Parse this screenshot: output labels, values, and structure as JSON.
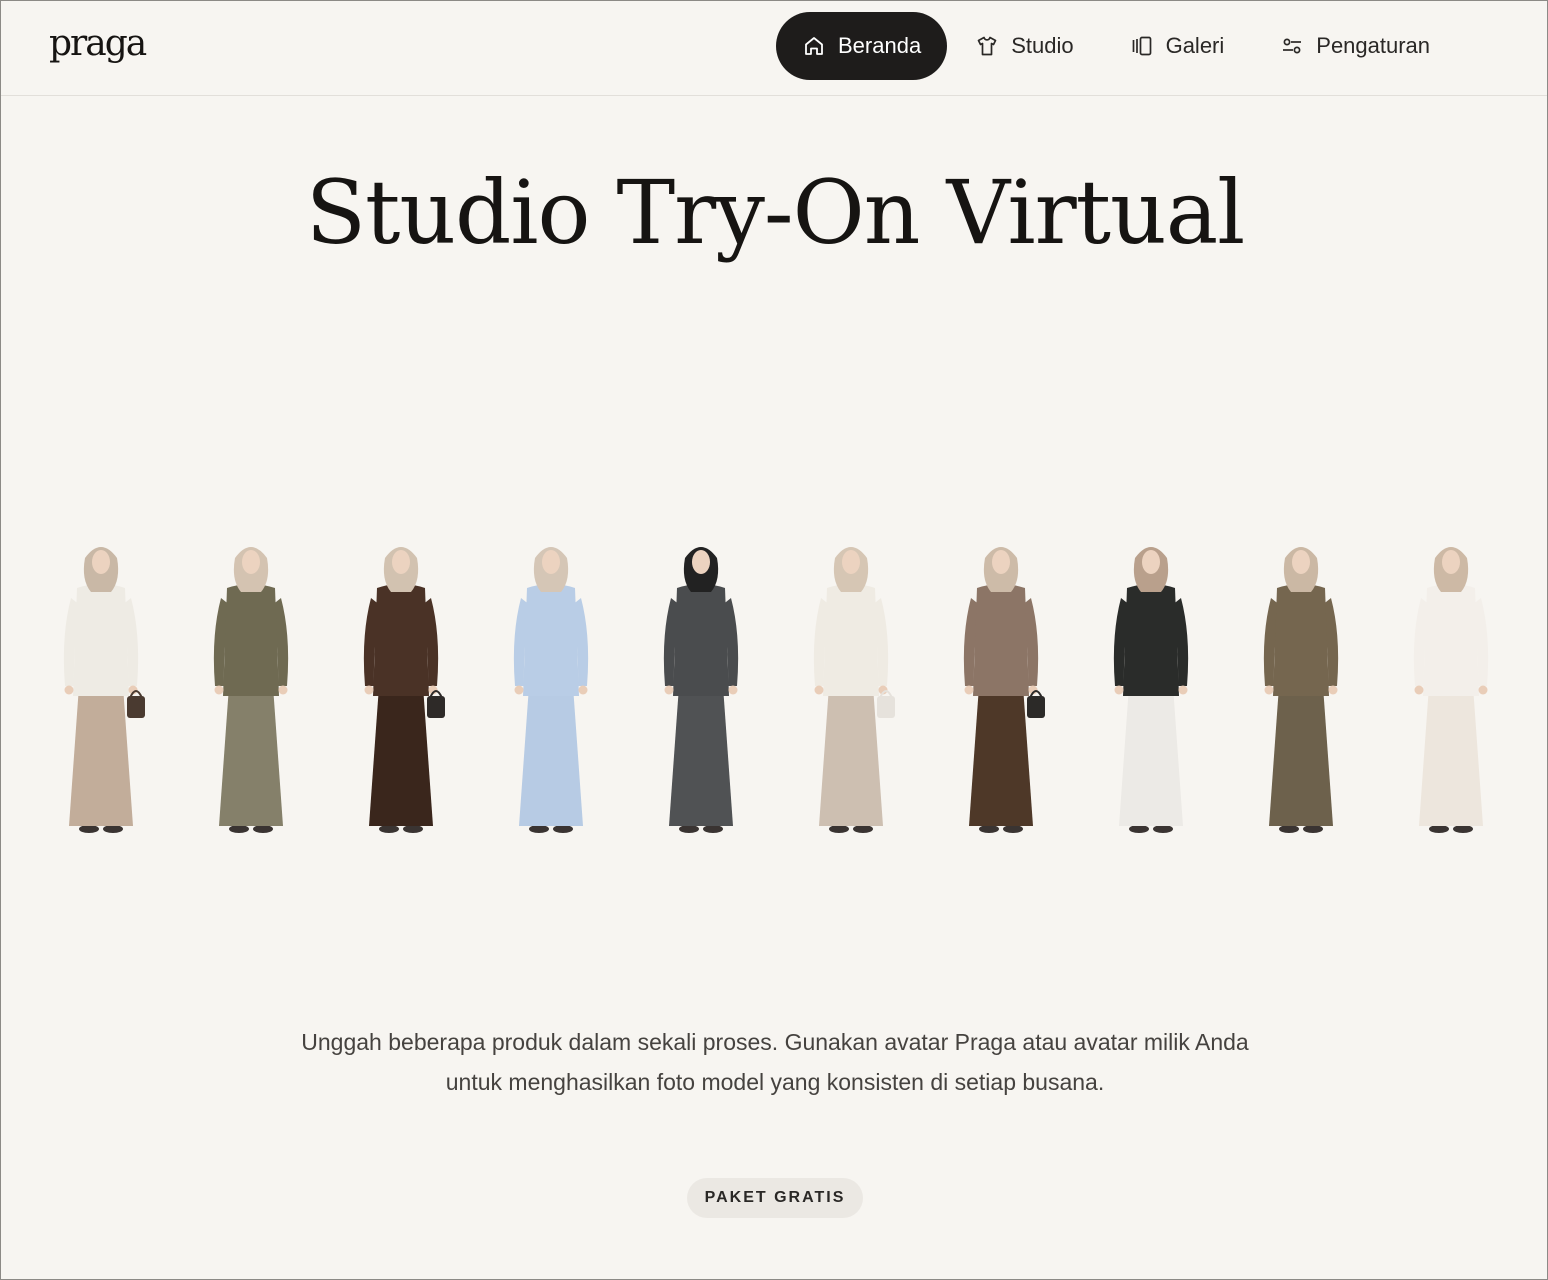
{
  "brand": {
    "logo_text": "praga"
  },
  "nav": {
    "items": [
      {
        "label": "Beranda",
        "icon": "home-icon",
        "active": true
      },
      {
        "label": "Studio",
        "icon": "shirt-icon",
        "active": false
      },
      {
        "label": "Galeri",
        "icon": "gallery-icon",
        "active": false
      },
      {
        "label": "Pengaturan",
        "icon": "sliders-icon",
        "active": false
      }
    ]
  },
  "hero": {
    "title": "Studio Try-On Virtual",
    "description": "Unggah beberapa produk dalam sekali proses. Gunakan avatar Praga atau avatar milik Anda untuk menghasilkan foto model yang konsisten di setiap busana.",
    "badge": "PAKET GRATIS"
  },
  "models": [
    {
      "hijab": "#c9b8a6",
      "top": "#eeebe4",
      "bottom": "#c2ad9a",
      "bag": "#4a3a30"
    },
    {
      "hijab": "#d4c3b1",
      "top": "#6f6a52",
      "bottom": "#85806a",
      "bag": ""
    },
    {
      "hijab": "#d2c2b0",
      "top": "#4a3226",
      "bottom": "#3a261c",
      "bag": "#2e2a28"
    },
    {
      "hijab": "#d5c6b6",
      "top": "#b9cde6",
      "bottom": "#b7cbe4",
      "bag": ""
    },
    {
      "hijab": "#222222",
      "top": "#4a4c4e",
      "bottom": "#505254",
      "bag": ""
    },
    {
      "hijab": "#d6c6b4",
      "top": "#efebe3",
      "bottom": "#cdbfb1",
      "bag": "#e6e2dc"
    },
    {
      "hijab": "#cdbba8",
      "top": "#8c7566",
      "bottom": "#4e3828",
      "bag": "#2c2a28"
    },
    {
      "hijab": "#b9a08c",
      "top": "#2a2c2a",
      "bottom": "#eceae6",
      "bag": ""
    },
    {
      "hijab": "#cbb8a4",
      "top": "#75664f",
      "bottom": "#6d614c",
      "bag": ""
    },
    {
      "hijab": "#cdb9a5",
      "top": "#f3efea",
      "bottom": "#ede6dd",
      "bag": ""
    }
  ]
}
